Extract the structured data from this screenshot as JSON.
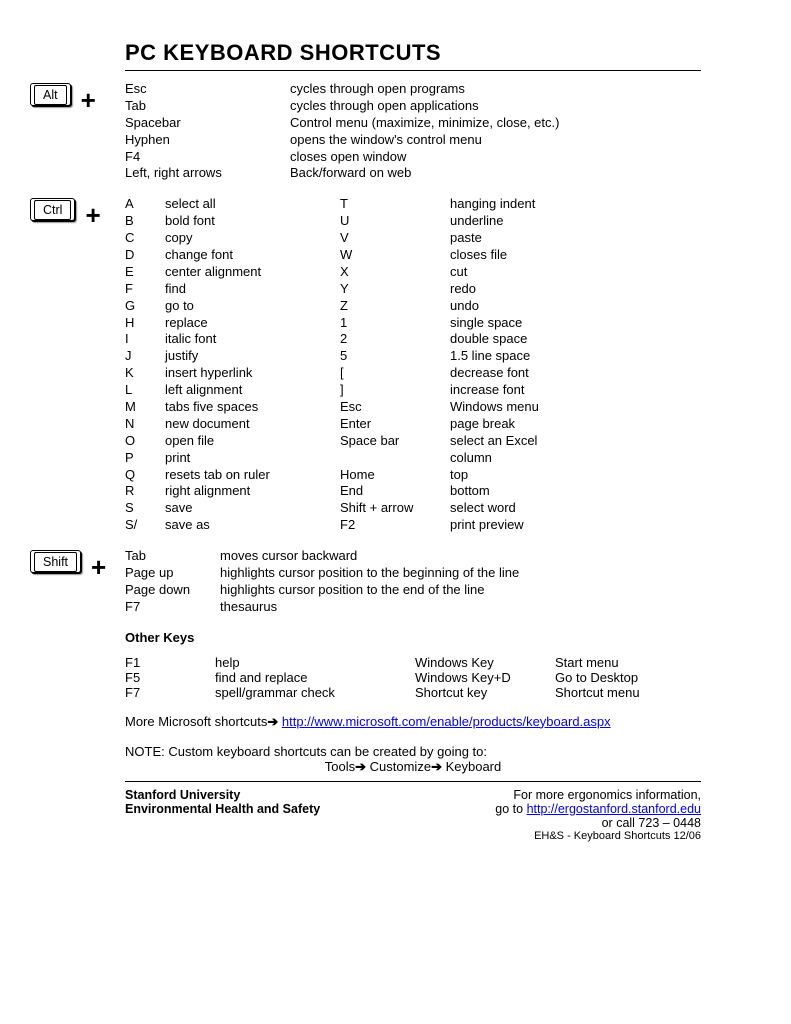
{
  "title": "PC KEYBOARD SHORTCUTS",
  "alt": {
    "key": "Alt",
    "rows": [
      [
        "Esc",
        "cycles through open programs"
      ],
      [
        "Tab",
        "cycles through open applications"
      ],
      [
        "Spacebar",
        "Control menu (maximize, minimize, close, etc.)"
      ],
      [
        "Hyphen",
        "opens the window's control menu"
      ],
      [
        "F4",
        "closes open window"
      ],
      [
        "Left, right arrows",
        "Back/forward on web"
      ]
    ]
  },
  "ctrl": {
    "key": "Ctrl",
    "rows": [
      [
        "A",
        "select all",
        "T",
        "hanging indent"
      ],
      [
        "B",
        "bold font",
        "U",
        "underline"
      ],
      [
        "C",
        "copy",
        "V",
        "paste"
      ],
      [
        "D",
        "change font",
        "W",
        "closes file"
      ],
      [
        "E",
        "center alignment",
        "X",
        "cut"
      ],
      [
        "F",
        "find",
        "Y",
        "redo"
      ],
      [
        "G",
        "go to",
        "Z",
        "undo"
      ],
      [
        "H",
        "replace",
        "1",
        "single space"
      ],
      [
        "I",
        "italic font",
        "2",
        "double space"
      ],
      [
        "J",
        "justify",
        "5",
        "1.5 line space"
      ],
      [
        "K",
        "insert hyperlink",
        "[",
        "decrease font"
      ],
      [
        "L",
        "left alignment",
        "]",
        "increase font"
      ],
      [
        "M",
        "tabs five spaces",
        "Esc",
        "Windows menu"
      ],
      [
        "N",
        "new document",
        "Enter",
        "page break"
      ],
      [
        "O",
        "open file",
        "Space bar",
        "select an Excel"
      ],
      [
        "P",
        "print",
        "",
        "column"
      ],
      [
        "Q",
        "resets tab on ruler",
        "Home",
        "top"
      ],
      [
        "R",
        "right alignment",
        "End",
        "bottom"
      ],
      [
        "S",
        "save",
        "Shift + arrow",
        "select word"
      ],
      [
        "S/",
        "save as",
        "F2",
        "print preview"
      ]
    ]
  },
  "shift": {
    "key": "Shift",
    "rows": [
      [
        "Tab",
        "moves cursor backward"
      ],
      [
        "Page up",
        "highlights cursor position to the beginning of the line"
      ],
      [
        "Page down",
        "highlights cursor position to the end of the line"
      ],
      [
        "F7",
        "thesaurus"
      ]
    ]
  },
  "other_heading": "Other Keys",
  "other_rows": [
    [
      "F1",
      "help",
      "Windows Key",
      "Start menu"
    ],
    [
      "F5",
      "find and replace",
      "Windows Key+D",
      "Go to Desktop"
    ],
    [
      "F7",
      "spell/grammar check",
      "Shortcut key",
      "Shortcut menu"
    ]
  ],
  "more_text": "More Microsoft shortcuts",
  "more_url": "http://www.microsoft.com/enable/products/keyboard.aspx",
  "note_line1": "NOTE: Custom keyboard shortcuts can be created by going to:",
  "note_tools": "Tools",
  "note_customize": "Customize",
  "note_keyboard": "Keyboard",
  "footer": {
    "org1": "Stanford University",
    "org2": "Environmental Health and Safety",
    "info1": "For more ergonomics information,",
    "info2_prefix": "go to ",
    "info2_url_text": "http://ergostanford.stanford.edu",
    "info3": "or call 723 – 0448",
    "info4": "EH&S - Keyboard Shortcuts 12/06"
  }
}
